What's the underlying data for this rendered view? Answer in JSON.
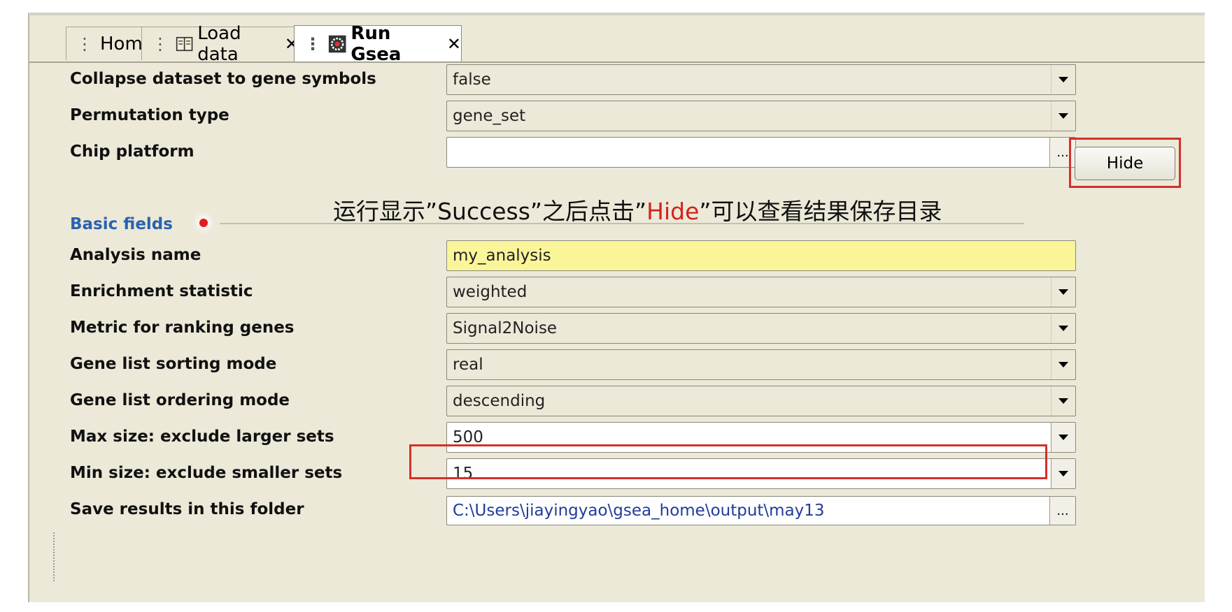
{
  "tabs": [
    {
      "label": "Home",
      "closable": false
    },
    {
      "label": "Load data",
      "closable": true
    },
    {
      "label": "Run Gsea",
      "closable": true,
      "active": true
    }
  ],
  "fields_top": [
    {
      "label": "Collapse dataset to gene symbols",
      "value": "false",
      "type": "dropdown"
    },
    {
      "label": "Permutation type",
      "value": "gene_set",
      "type": "dropdown"
    },
    {
      "label": "Chip platform",
      "value": "",
      "type": "browse"
    }
  ],
  "basic_section": {
    "title": "Basic fields"
  },
  "annotation": {
    "prefix": "运行显示”Success”之后点击”",
    "highlight": "Hide",
    "suffix": "”可以查看结果保存目录"
  },
  "hide_button": {
    "label": "Hide"
  },
  "fields_basic": [
    {
      "label": "Analysis name",
      "value": "my_analysis",
      "type": "text"
    },
    {
      "label": "Enrichment statistic",
      "value": "weighted",
      "type": "dropdown"
    },
    {
      "label": "Metric for ranking genes",
      "value": "Signal2Noise",
      "type": "dropdown"
    },
    {
      "label": "Gene list sorting mode",
      "value": "real",
      "type": "dropdown"
    },
    {
      "label": "Gene list ordering mode",
      "value": "descending",
      "type": "dropdown"
    },
    {
      "label": "Max size: exclude larger sets",
      "value": "500",
      "type": "editable-dropdown"
    },
    {
      "label": "Min size: exclude smaller sets",
      "value": "15",
      "type": "editable-dropdown"
    },
    {
      "label": "Save results in this folder",
      "value": "C:\\Users\\jiayingyao\\gsea_home\\output\\may13",
      "type": "browse"
    }
  ],
  "browse_label": "...",
  "colors": {
    "accent_red": "#d4302a",
    "section_blue": "#2a62b0",
    "analysis_bg": "#fbf59a"
  }
}
